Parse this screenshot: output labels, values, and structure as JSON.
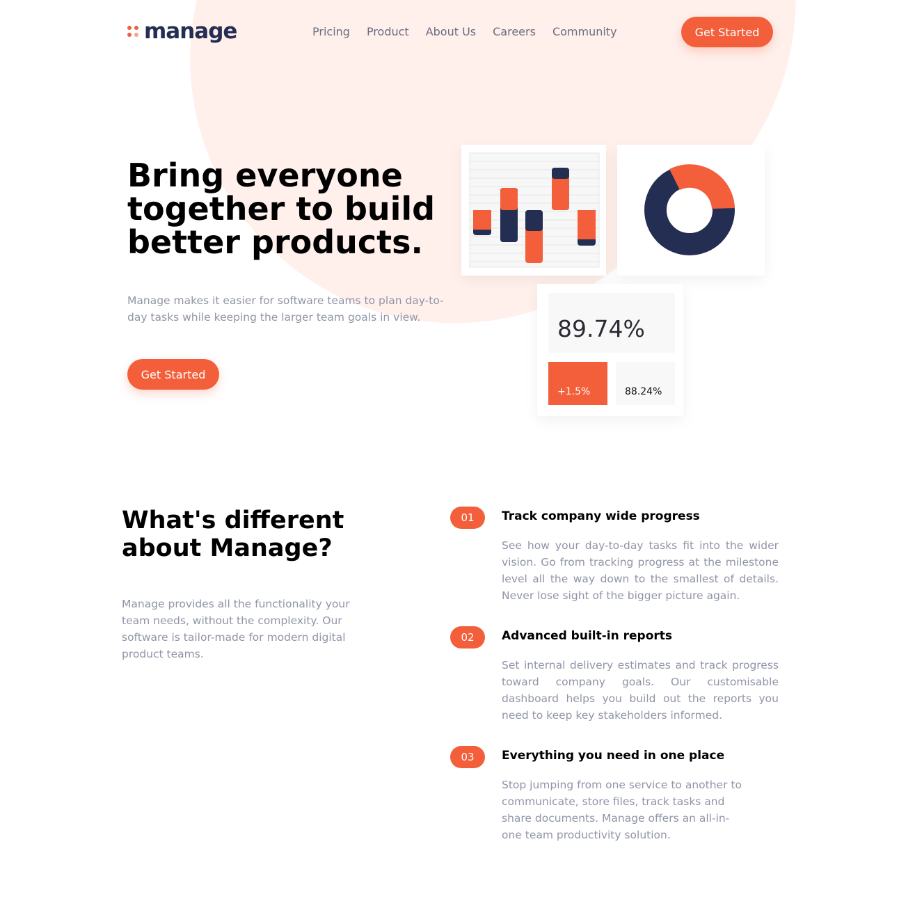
{
  "header": {
    "logo_text": "manage",
    "nav": [
      "Pricing",
      "Product",
      "About Us",
      "Careers",
      "Community"
    ],
    "cta_label": "Get Started"
  },
  "hero": {
    "title": "Bring everyone together to build better products.",
    "description": "Manage makes it easier for software teams to plan day-to-day tasks while keeping the larger team goals in view.",
    "cta_label": "Get Started"
  },
  "dashboard": {
    "stat_main": "89.74%",
    "stat_change": "+1.5%",
    "stat_secondary": "88.24%"
  },
  "features": {
    "title": "What's different about Manage?",
    "description": "Manage provides all the functionality your team needs, without the complexity. Our software is tailor-made for modern digital product teams.",
    "items": [
      {
        "number": "01",
        "title": "Track company wide progress",
        "text": "See how your day-to-day tasks fit into the wider vision. Go from tracking progress at the milestone level all the way down to the smallest of details. Never lose sight of the bigger picture again."
      },
      {
        "number": "02",
        "title": "Advanced built-in reports",
        "text": "Set internal delivery estimates and track progress toward company goals. Our customisable dashboard helps you build out the reports you need to keep key stakeholders informed."
      },
      {
        "number": "03",
        "title": "Everything you need in one place",
        "text": "Stop jumping from one service to another to communicate, store files, track tasks and share documents. Manage offers an all-in-one team productivity solution."
      }
    ]
  },
  "colors": {
    "accent": "#f25f3a",
    "navy": "#242d52",
    "muted_text": "#9095a7",
    "pale_accent": "#fff0ec"
  }
}
